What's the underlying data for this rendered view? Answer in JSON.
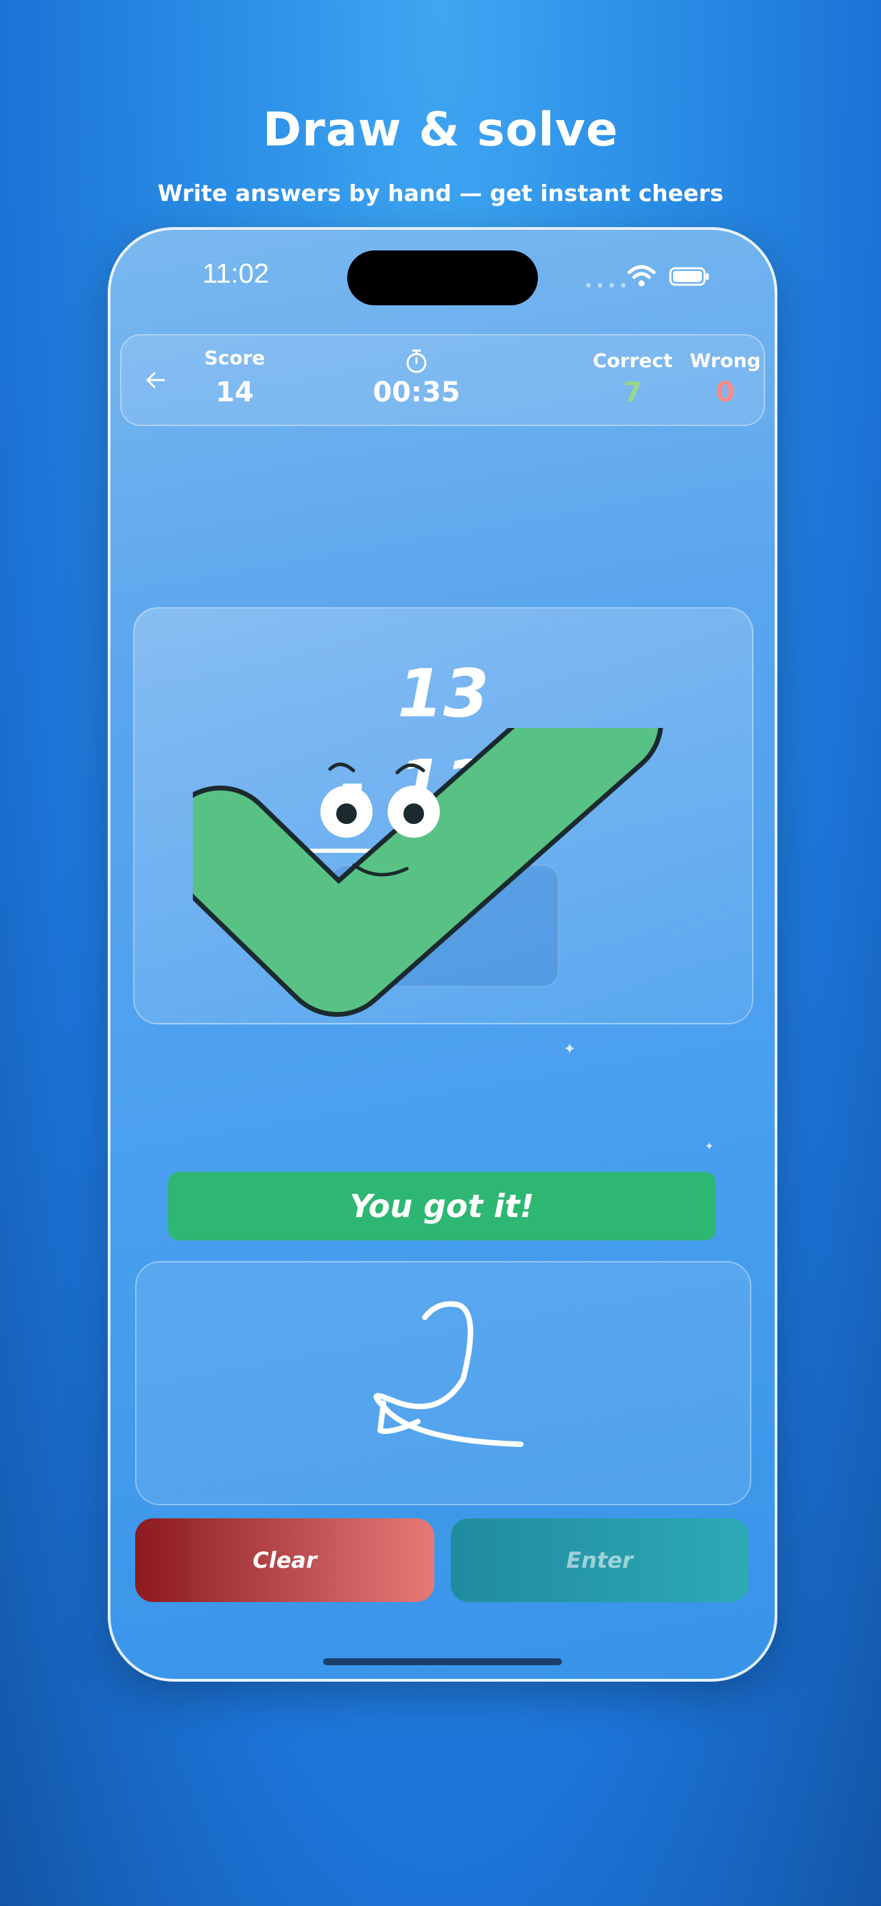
{
  "promo": {
    "title": "Draw & solve",
    "subtitle": "Write answers by hand — get instant cheers"
  },
  "status_bar": {
    "time": "11:02"
  },
  "hud": {
    "score_label": "Score",
    "score_value": "14",
    "timer": "00:35",
    "correct_label": "Correct",
    "correct_value": "7",
    "wrong_label": "Wrong",
    "wrong_value": "0",
    "correct_color": "#9bd68a",
    "wrong_color": "#ff8a8a"
  },
  "problem": {
    "top_number": "13",
    "operator": "–",
    "bottom_number": "11"
  },
  "feedback": {
    "message": "You got it!",
    "color": "#2eb673"
  },
  "drawing": {
    "handwritten_answer": "2"
  },
  "buttons": {
    "clear_label": "Clear",
    "enter_label": "Enter"
  },
  "icons": [
    "back-arrow-icon",
    "stopwatch-icon",
    "wifi-icon",
    "battery-icon",
    "checkmark-mascot"
  ]
}
